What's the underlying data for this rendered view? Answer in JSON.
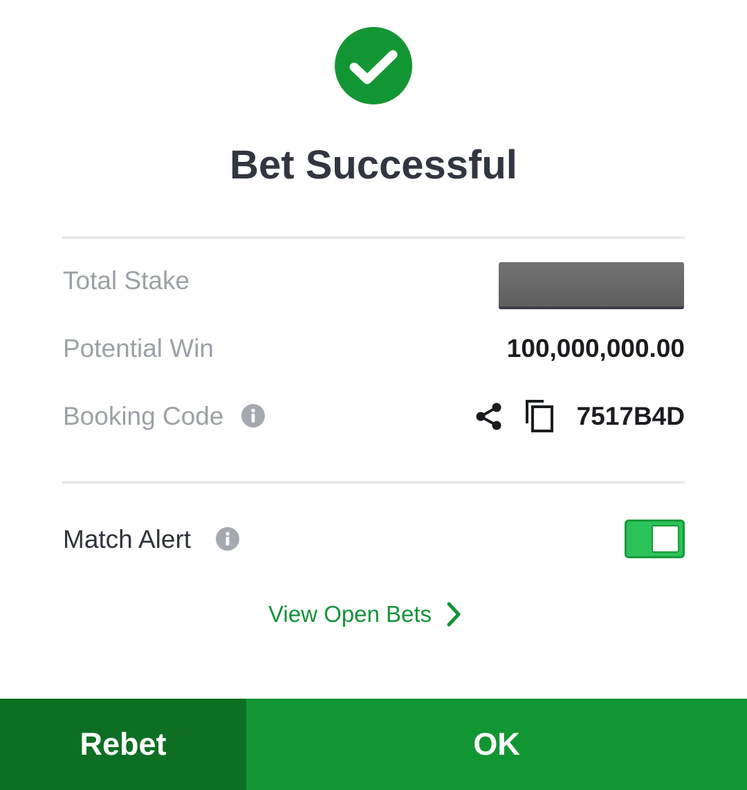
{
  "colors": {
    "success_green": "#129633",
    "dark_green": "#0e6f24",
    "toggle_on": "#2cc25a",
    "label_gray": "#9ca0a8",
    "title_color": "#323640",
    "link_green": "#15923a"
  },
  "header": {
    "icon": "check-circle-icon",
    "title": "Bet Successful"
  },
  "summary": {
    "total_stake": {
      "label": "Total Stake",
      "value_redacted": true
    },
    "potential_win": {
      "label": "Potential Win",
      "value": "100,000,000.00"
    },
    "booking_code": {
      "label": "Booking Code",
      "info_icon": "info-icon",
      "share_icon": "share-icon",
      "copy_icon": "copy-icon",
      "value": "7517B4D"
    }
  },
  "match_alert": {
    "label": "Match Alert",
    "info_icon": "info-icon",
    "enabled": true
  },
  "links": {
    "view_open_bets": "View Open Bets",
    "chevron_icon": "chevron-right-icon"
  },
  "footer": {
    "rebet_label": "Rebet",
    "ok_label": "OK"
  }
}
